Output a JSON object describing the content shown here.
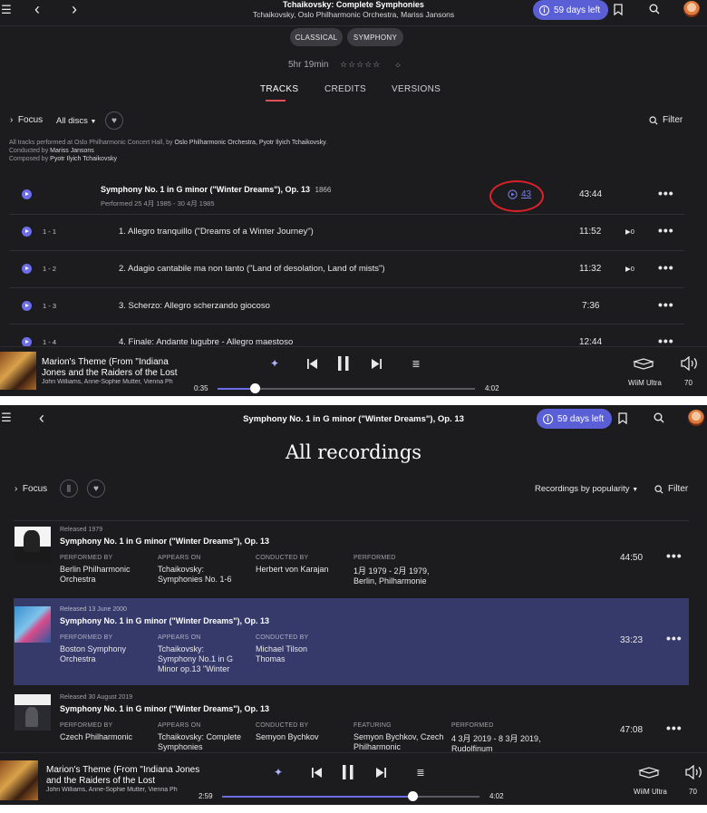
{
  "top": {
    "header": {
      "title": "Tchaikovsky: Complete Symphonies",
      "subtitle": "Tchaikovsky, Oslo Philharmonic Orchestra, Mariss Jansons",
      "trial": "59 days left"
    },
    "chips": [
      "CLASSICAL",
      "SYMPHONY"
    ],
    "duration": "5hr 19min",
    "rating": "☆☆☆☆☆",
    "tabs": [
      "TRACKS",
      "CREDITS",
      "VERSIONS"
    ],
    "toolbar": {
      "focus": "Focus",
      "all_discs": "All discs",
      "filter": "Filter"
    },
    "info": {
      "line1_prefix": "All tracks performed at Oslo Philharmonic Concert Hall, by",
      "line1_link": "Oslo Philharmonic Orchestra, Pyotr Ilyich Tchaikovsky",
      "line1_suffix": ".",
      "line2_prefix": "Conducted by",
      "line2_link": "Mariss Jansons",
      "line3_prefix": "Composed by",
      "line3_link": "Pyotr Ilyich Tchaikovsky"
    },
    "work": {
      "title": "Symphony No. 1 in G minor (\"Winter Dreams\"), Op. 13",
      "year": "1866",
      "performed": "Performed 25 4月 1985 - 30 4月 1985",
      "versions": "43",
      "duration": "43:44"
    },
    "tracks": [
      {
        "num": "1 - 1",
        "title": "1. Allegro tranquillo (\"Dreams of a Winter Journey\")",
        "duration": "11:52",
        "plays": "0"
      },
      {
        "num": "1 - 2",
        "title": "2. Adagio cantabile ma non tanto (\"Land of desolation, Land of mists\")",
        "duration": "11:32",
        "plays": "0"
      },
      {
        "num": "1 - 3",
        "title": "3. Scherzo: Allegro scherzando giocoso",
        "duration": "7:36",
        "plays": ""
      },
      {
        "num": "1 - 4",
        "title": "4. Finale: Andante lugubre - Allegro maestoso",
        "duration": "12:44",
        "plays": ""
      }
    ],
    "player": {
      "title": "Marion's Theme (From \"Indiana Jones and the Raiders of the Lost",
      "artist": "John Williams, Anne-Sophie Mutter, Vienna Ph",
      "elapsed": "0:35",
      "total": "4:02",
      "progress": 0.145,
      "device": "WiiM Ultra",
      "volume": "70"
    }
  },
  "bottom": {
    "header": {
      "title": "Symphony No. 1 in G minor (\"Winter Dreams\"), Op. 13",
      "trial": "59 days left"
    },
    "page_title": "All recordings",
    "toolbar": {
      "focus": "Focus",
      "sort": "Recordings by popularity",
      "filter": "Filter"
    },
    "recordings": [
      {
        "released": "Released 1979",
        "title": "Symphony No. 1 in G minor (\"Winter Dreams\"), Op. 13",
        "cols": [
          {
            "label": "PERFORMED BY",
            "value": "Berlin Philharmonic Orchestra"
          },
          {
            "label": "APPEARS ON",
            "value": "Tchaikovsky: Symphonies No. 1-6"
          },
          {
            "label": "CONDUCTED BY",
            "value": "Herbert von Karajan"
          },
          {
            "label": "PERFORMED",
            "value": "1月 1979 - 2月 1979, Berlin, Philharmonie"
          }
        ],
        "duration": "44:50"
      },
      {
        "released": "Released 13 June 2000",
        "title": "Symphony No. 1 in G minor (\"Winter Dreams\"), Op. 13",
        "cols": [
          {
            "label": "PERFORMED BY",
            "value": "Boston Symphony Orchestra"
          },
          {
            "label": "APPEARS ON",
            "value": "Tchaikovsky: Symphony No.1 in G Minor op.13 \"Winter"
          },
          {
            "label": "CONDUCTED BY",
            "value": "Michael Tilson Thomas"
          }
        ],
        "duration": "33:23"
      },
      {
        "released": "Released 30 August 2019",
        "title": "Symphony No. 1 in G minor (\"Winter Dreams\"), Op. 13",
        "cols": [
          {
            "label": "PERFORMED BY",
            "value": "Czech Philharmonic"
          },
          {
            "label": "APPEARS ON",
            "value": "Tchaikovsky: Complete Symphonies"
          },
          {
            "label": "CONDUCTED BY",
            "value": "Semyon Bychkov"
          },
          {
            "label": "FEATURING",
            "value": "Semyon Bychkov, Czech Philharmonic"
          },
          {
            "label": "PERFORMED",
            "value": "4 3月 2019 - 8 3月 2019, Rudolfinum"
          }
        ],
        "duration": "47:08"
      }
    ],
    "player": {
      "title": "Marion's Theme (From \"Indiana Jones and the Raiders of the Lost",
      "artist": "John Williams, Anne-Sophie Mutter, Vienna Ph",
      "elapsed": "2:59",
      "total": "4:02",
      "progress": 0.74,
      "device": "WiiM Ultra",
      "volume": "70"
    }
  },
  "colors": {
    "background": "#1c1c1f",
    "accent": "#5b5fd6",
    "highlight_row": "#363a6b",
    "tab_underline": "#e0505a",
    "annotation": "#e0202a"
  }
}
